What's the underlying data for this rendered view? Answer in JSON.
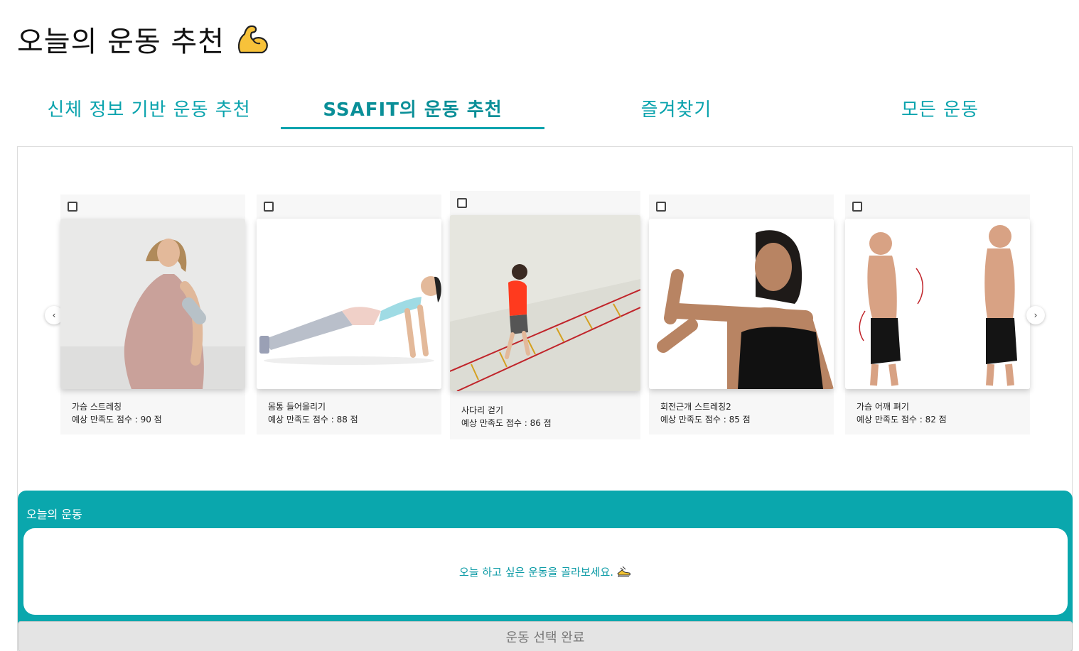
{
  "page": {
    "title": "오늘의 운동 추천",
    "title_icon": "flexed-biceps-icon"
  },
  "tabs": [
    {
      "label": "신체 정보 기반 운동 추천",
      "active": false
    },
    {
      "label": "SSAFIT의 운동 추천",
      "active": true
    },
    {
      "label": "즐겨찾기",
      "active": false
    },
    {
      "label": "모든 운동",
      "active": false
    }
  ],
  "carousel": {
    "prev_label": "‹",
    "next_label": "›",
    "cards": [
      {
        "name": "가슴 스트레칭",
        "score_text": "예상 만족도 점수 : 90 점",
        "image": "woman-chest-stretch"
      },
      {
        "name": "몸통 들어올리기",
        "score_text": "예상 만족도 점수 : 88 점",
        "image": "woman-reverse-plank"
      },
      {
        "name": "사다리 걷기",
        "score_text": "예상 만족도 점수 : 86 점",
        "image": "person-ladder-walk"
      },
      {
        "name": "회전근개 스트레칭2",
        "score_text": "예상 만족도 점수 : 85 점",
        "image": "woman-arm-stretch"
      },
      {
        "name": "가슴 어깨 펴기",
        "score_text": "예상 만족도 점수 : 82 점",
        "image": "man-posture"
      }
    ]
  },
  "today": {
    "title": "오늘의 운동",
    "message": "오늘 하고 싶은 운동을 골라보세요.",
    "message_icon": "running-shoe-icon"
  },
  "done_button": "운동 선택 완료",
  "colors": {
    "accent": "#0aa7ad",
    "tab_text": "#0aa3ad",
    "button_bg": "#e4e4e4"
  }
}
